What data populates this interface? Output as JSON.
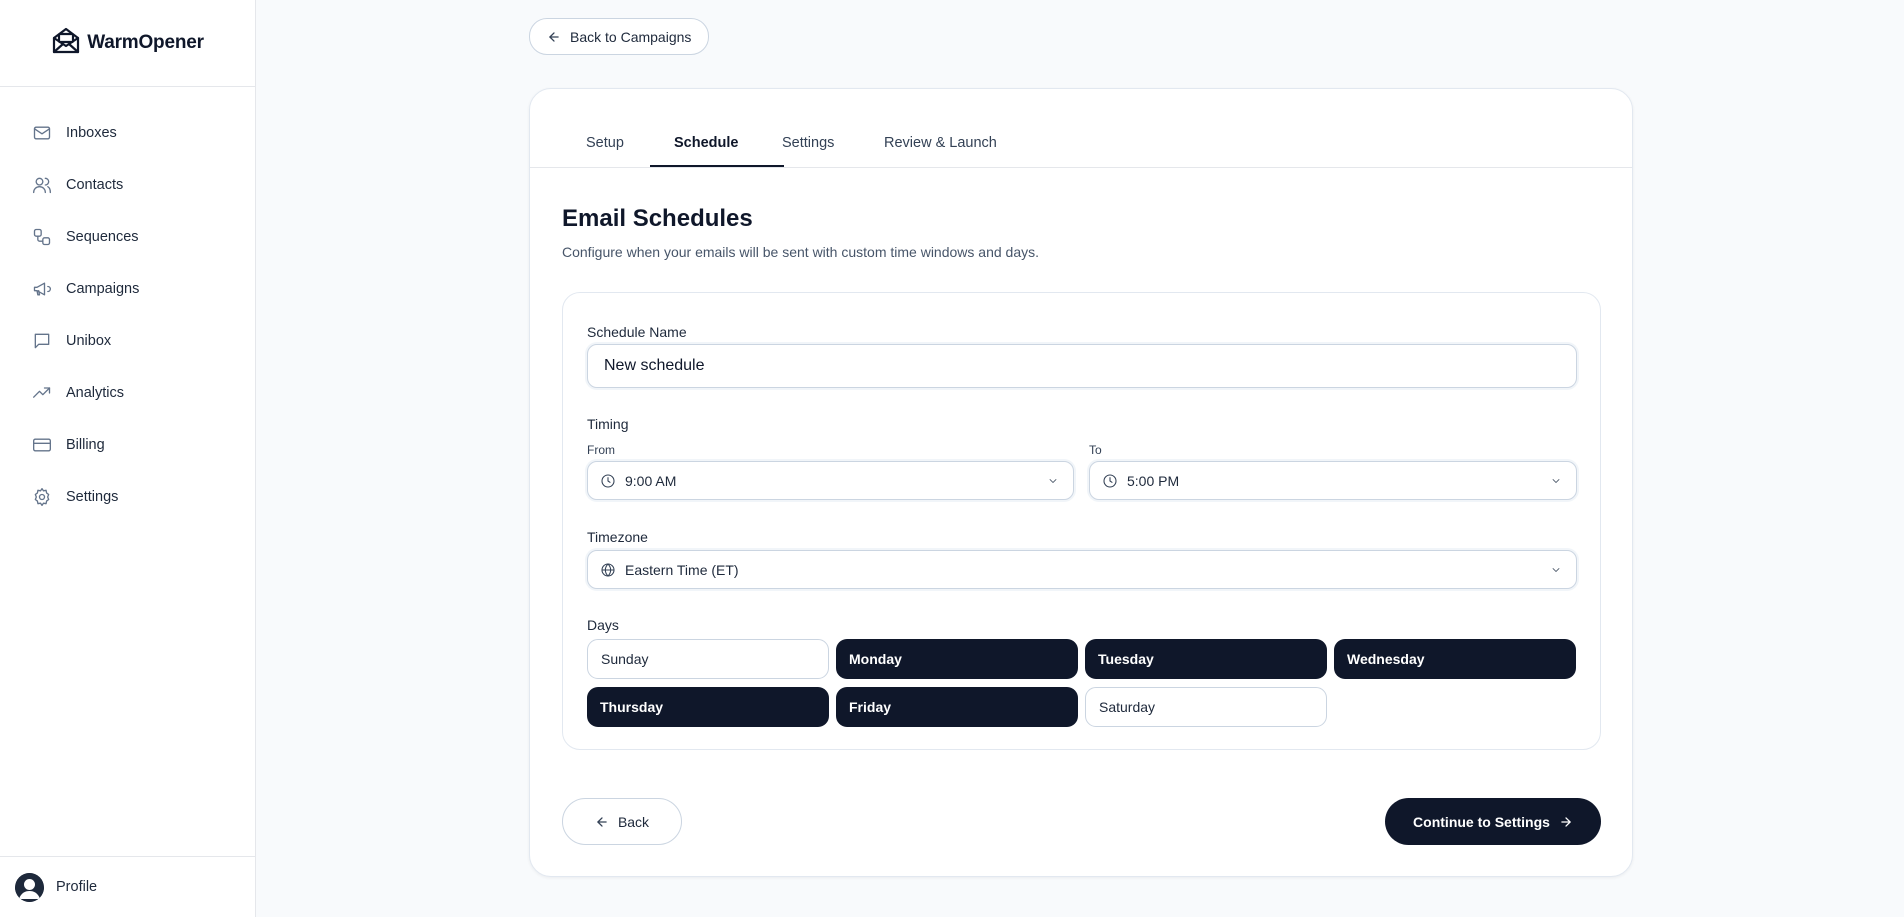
{
  "app": {
    "brand_name": "WarmOpener"
  },
  "sidebar": {
    "items": [
      {
        "label": "Inboxes",
        "icon": "mail-icon"
      },
      {
        "label": "Contacts",
        "icon": "users-icon"
      },
      {
        "label": "Sequences",
        "icon": "workflow-icon"
      },
      {
        "label": "Campaigns",
        "icon": "megaphone-icon"
      },
      {
        "label": "Unibox",
        "icon": "message-square-icon"
      },
      {
        "label": "Analytics",
        "icon": "trending-up-icon"
      },
      {
        "label": "Billing",
        "icon": "credit-card-icon"
      },
      {
        "label": "Settings",
        "icon": "gear-icon"
      }
    ],
    "profile_label": "Profile"
  },
  "header": {
    "back_label": "Back to Campaigns"
  },
  "tabs": [
    {
      "label": "Setup",
      "active": false
    },
    {
      "label": "Schedule",
      "active": true
    },
    {
      "label": "Settings",
      "active": false
    },
    {
      "label": "Review & Launch",
      "active": false
    }
  ],
  "schedule": {
    "title": "Email Schedules",
    "description": "Configure when your emails will be sent with custom time windows and days.",
    "name_label": "Schedule Name",
    "name_value": "New schedule",
    "timing_label": "Timing",
    "from_label": "From",
    "from_value": "9:00 AM",
    "to_label": "To",
    "to_value": "5:00 PM",
    "timezone_label": "Timezone",
    "timezone_value": "Eastern Time (ET)",
    "days_label": "Days",
    "days": [
      {
        "label": "Sunday",
        "selected": false
      },
      {
        "label": "Monday",
        "selected": true
      },
      {
        "label": "Tuesday",
        "selected": true
      },
      {
        "label": "Wednesday",
        "selected": true
      },
      {
        "label": "Thursday",
        "selected": true
      },
      {
        "label": "Friday",
        "selected": true
      },
      {
        "label": "Saturday",
        "selected": false
      }
    ]
  },
  "footer": {
    "back_label": "Back",
    "continue_label": "Continue to Settings"
  },
  "colors": {
    "primary": "#0f172a",
    "background": "#f8fafc",
    "border": "#cbd5e1",
    "muted_text": "#475569"
  }
}
